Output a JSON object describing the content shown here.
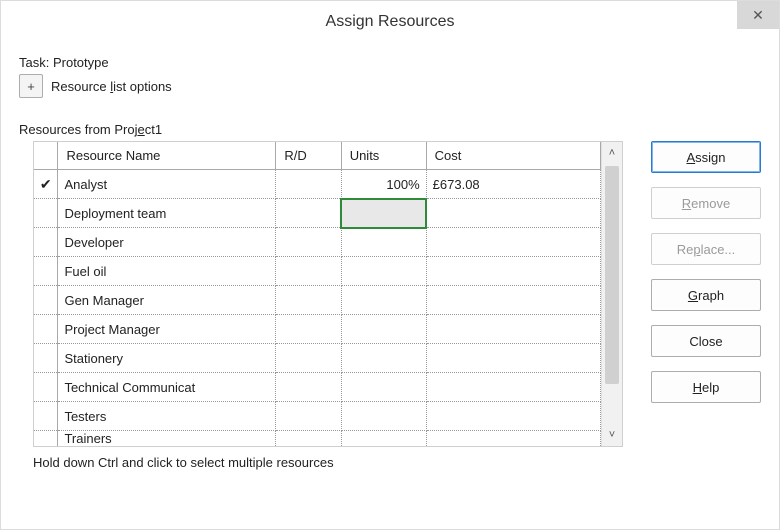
{
  "window": {
    "title": "Assign Resources",
    "close_glyph": "✕"
  },
  "task": {
    "prefix": "Task:",
    "name": "Prototype"
  },
  "options": {
    "expand_glyph": "+",
    "label_pre": "Resource ",
    "label_ul": "l",
    "label_post": "ist options"
  },
  "fieldset": {
    "label_pre": "Resources from Proj",
    "label_ul": "e",
    "label_post": "ct1"
  },
  "columns": {
    "name": "Resource Name",
    "rd": "R/D",
    "units": "Units",
    "cost": "Cost"
  },
  "rows": [
    {
      "checked": true,
      "name": "Analyst",
      "rd": "",
      "units": "100%",
      "cost": "£673.08"
    },
    {
      "checked": false,
      "name": "Deployment team",
      "rd": "",
      "units": "",
      "cost": "",
      "selected_units": true
    },
    {
      "checked": false,
      "name": "Developer",
      "rd": "",
      "units": "",
      "cost": ""
    },
    {
      "checked": false,
      "name": "Fuel oil",
      "rd": "",
      "units": "",
      "cost": ""
    },
    {
      "checked": false,
      "name": "Gen Manager",
      "rd": "",
      "units": "",
      "cost": ""
    },
    {
      "checked": false,
      "name": "Project Manager",
      "rd": "",
      "units": "",
      "cost": ""
    },
    {
      "checked": false,
      "name": "Stationery",
      "rd": "",
      "units": "",
      "cost": ""
    },
    {
      "checked": false,
      "name": "Technical Communicat",
      "rd": "",
      "units": "",
      "cost": ""
    },
    {
      "checked": false,
      "name": "Testers",
      "rd": "",
      "units": "",
      "cost": ""
    },
    {
      "checked": false,
      "name": "Trainers",
      "rd": "",
      "units": "",
      "cost": "",
      "partial": true
    }
  ],
  "hint": "Hold down Ctrl and click to select multiple resources",
  "buttons": {
    "assign": {
      "ul": "A",
      "rest": "ssign"
    },
    "remove": {
      "ul": "R",
      "rest": "emove"
    },
    "replace": {
      "pre": "Re",
      "ul": "p",
      "rest": "lace..."
    },
    "graph": {
      "ul": "G",
      "rest": "raph"
    },
    "close": {
      "text": "Close"
    },
    "help": {
      "ul": "H",
      "rest": "elp"
    }
  },
  "scroll": {
    "up_glyph": "˄",
    "down_glyph": "˅"
  }
}
